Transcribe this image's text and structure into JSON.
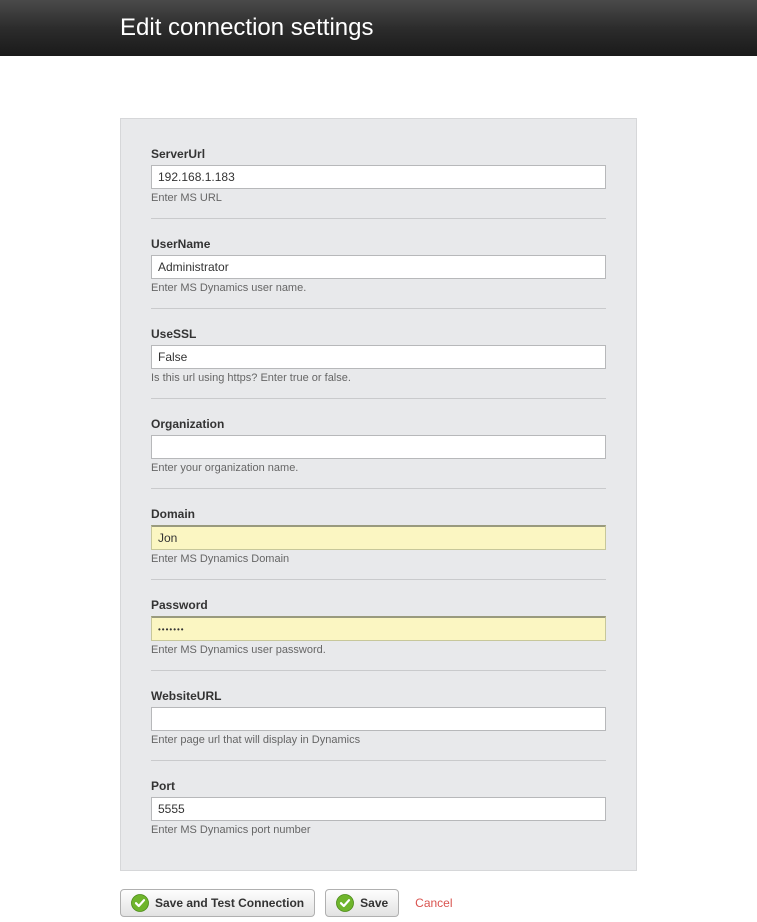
{
  "header": {
    "title": "Edit connection settings"
  },
  "form": {
    "serverUrl": {
      "label": "ServerUrl",
      "value": "192.168.1.183",
      "hint": "Enter MS URL"
    },
    "userName": {
      "label": "UserName",
      "value": "Administrator",
      "hint": "Enter MS Dynamics user name."
    },
    "useSsl": {
      "label": "UseSSL",
      "value": "False",
      "hint": "Is this url using https? Enter true or false."
    },
    "organization": {
      "label": "Organization",
      "value": "",
      "hint": "Enter your organization name."
    },
    "domain": {
      "label": "Domain",
      "value": "Jon",
      "hint": "Enter MS Dynamics Domain"
    },
    "password": {
      "label": "Password",
      "value": "•••••••",
      "hint": "Enter MS Dynamics user password."
    },
    "websiteUrl": {
      "label": "WebsiteURL",
      "value": "",
      "hint": "Enter page url that will display in Dynamics"
    },
    "port": {
      "label": "Port",
      "value": "5555",
      "hint": "Enter MS Dynamics port number"
    }
  },
  "actions": {
    "saveTest": "Save and Test Connection",
    "save": "Save",
    "cancel": "Cancel"
  }
}
